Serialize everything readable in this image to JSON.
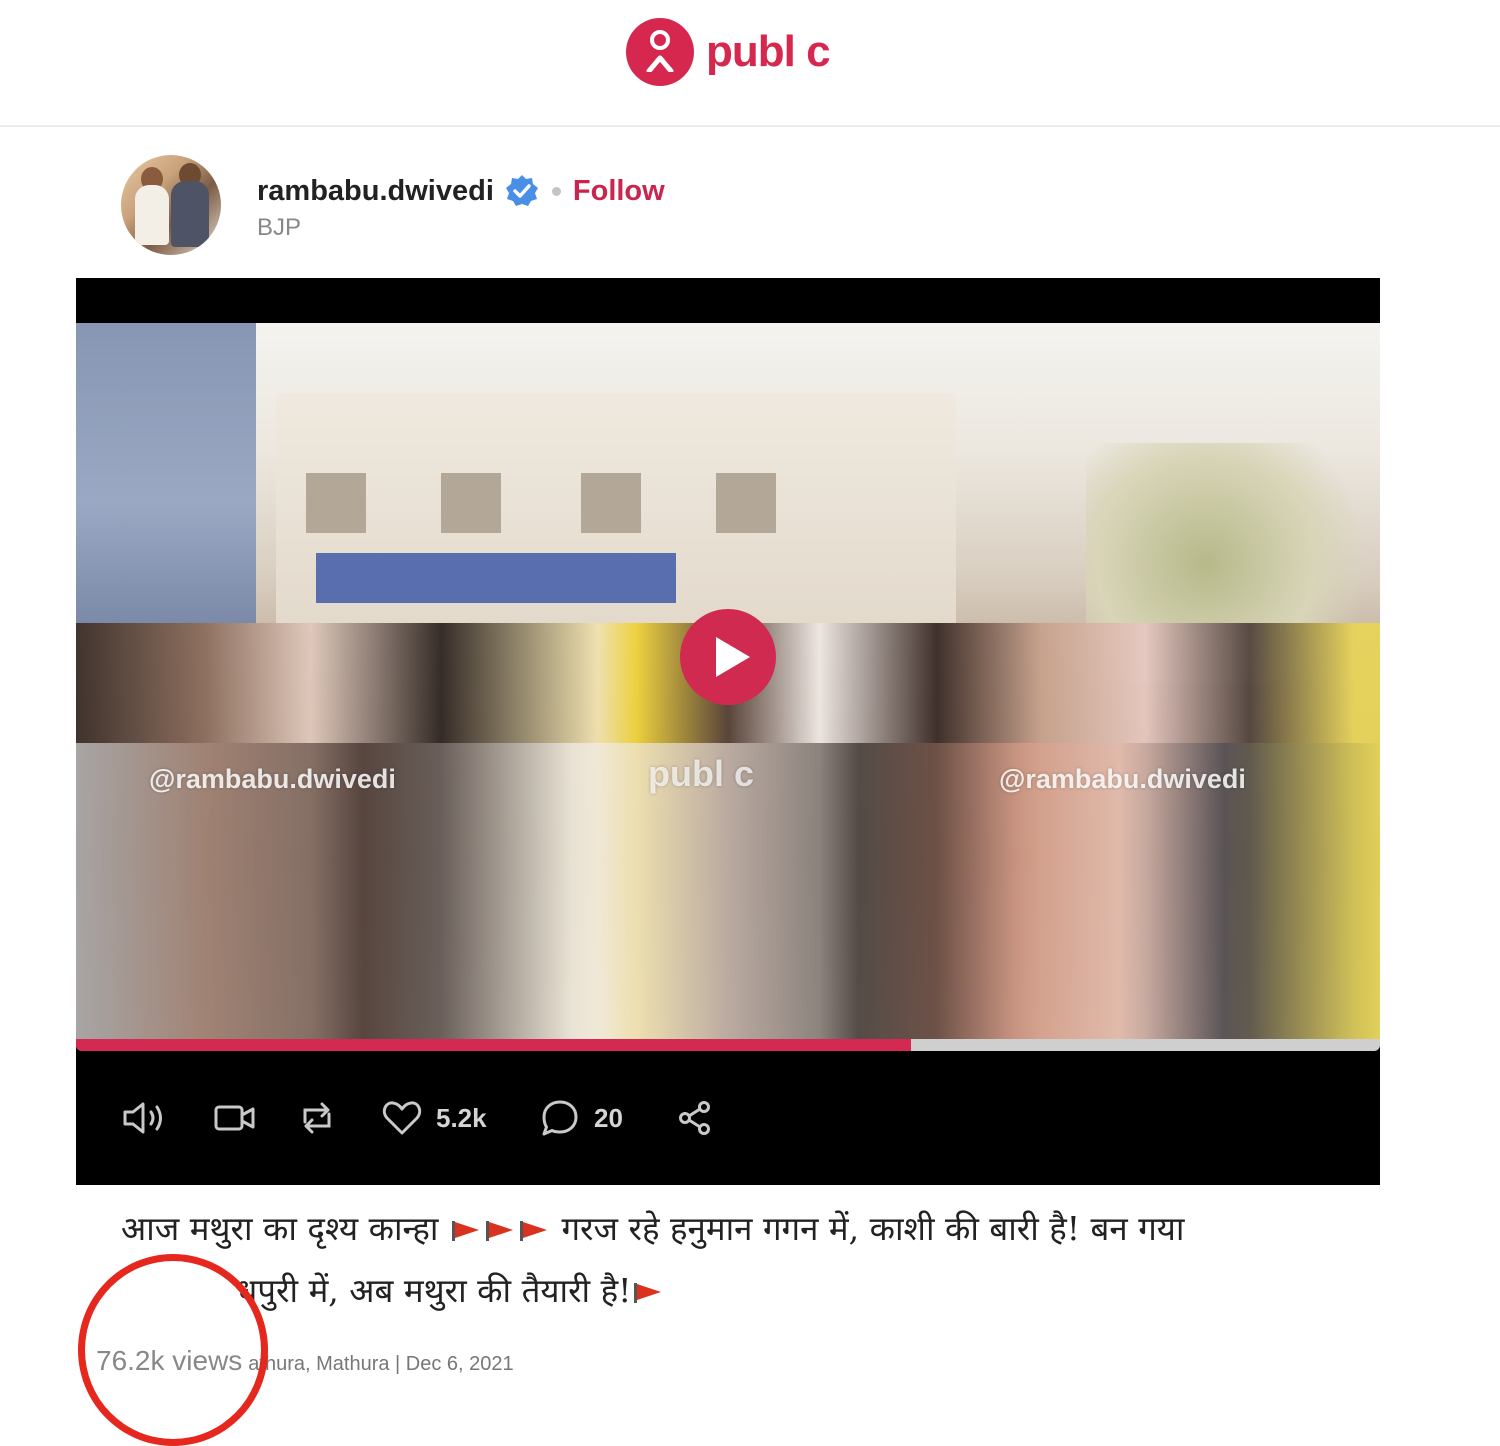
{
  "header": {
    "brand_name": "publ c",
    "brand_color": "#d6284e"
  },
  "post": {
    "author": {
      "username": "rambabu.dwivedi",
      "verified": true,
      "follow_label": "Follow",
      "affiliation": "BJP"
    },
    "video": {
      "watermark_left": "@rambabu.dwivedi",
      "watermark_center": "publ c",
      "watermark_right": "@rambabu.dwivedi",
      "progress": 0.64,
      "progress_color": "#d42a52"
    },
    "actions": {
      "likes": "5.2k",
      "comments": "20"
    },
    "caption": {
      "line1": "आज मथुरा का दृश्य कान्हा",
      "line1_after": "गरज रहे हनुमान गगन में, काशी की बारी है! बन गया",
      "line2": "धपुरी में, अब मथुरा की तैयारी है!"
    },
    "meta": {
      "views": "76.2k views",
      "place_date": "athura, Mathura | Dec 6, 2021"
    }
  },
  "icons": [
    "volume-icon",
    "video-camera-icon",
    "repost-icon",
    "heart-icon",
    "comment-icon",
    "share-icon",
    "play-icon",
    "verified-badge-icon",
    "flag-icon"
  ]
}
